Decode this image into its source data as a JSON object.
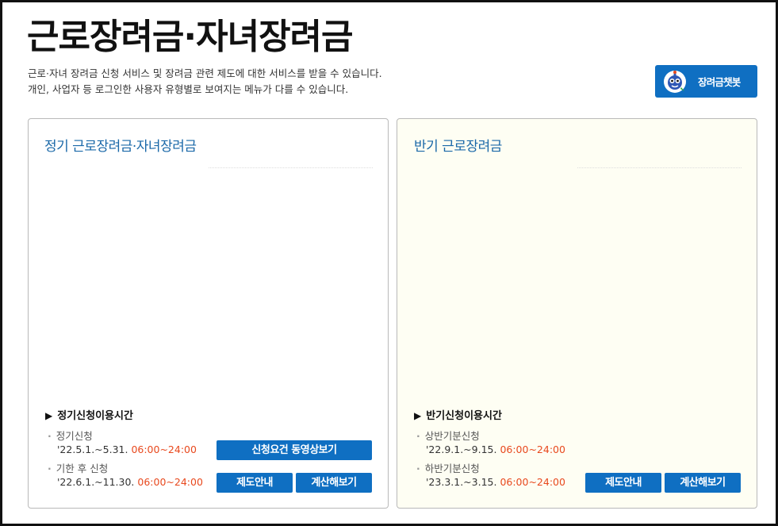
{
  "page": {
    "title": "근로장려금·자녀장려금",
    "desc_line1": "근로·자녀 장려금 신청 서비스 및 장려금 관련 제도에 대한 서비스를 받을 수 있습니다.",
    "desc_line2": "개인, 사업자 등 로그인한 사용자 유형별로 보여지는 메뉴가 다를 수 있습니다."
  },
  "chatbot": {
    "label": "장려금챗봇",
    "icon": "robot-icon"
  },
  "left_panel": {
    "title": "정기 근로장려금·자녀장려금",
    "hours_title": "정기신청이용시간",
    "items": [
      {
        "name": "정기신청",
        "date": "'22.5.1.~5.31.",
        "time": "06:00~24:00"
      },
      {
        "name": "기한 후 신청",
        "date": "'22.6.1.~11.30.",
        "time": "06:00~24:00"
      }
    ],
    "buttons": {
      "video": "신청요건 동영상보기",
      "guide": "제도안내",
      "calc": "계산해보기"
    }
  },
  "right_panel": {
    "title": "반기 근로장려금",
    "hours_title": "반기신청이용시간",
    "items": [
      {
        "name": "상반기분신청",
        "date": "'22.9.1.~9.15.",
        "time": "06:00~24:00"
      },
      {
        "name": "하반기분신청",
        "date": "'23.3.1.~3.15.",
        "time": "06:00~24:00"
      }
    ],
    "buttons": {
      "guide": "제도안내",
      "calc": "계산해보기"
    }
  },
  "colors": {
    "accent": "#0f6fc2",
    "panel_title": "#1a68a8",
    "time": "#e8491e",
    "right_bg": "#fefef3"
  }
}
